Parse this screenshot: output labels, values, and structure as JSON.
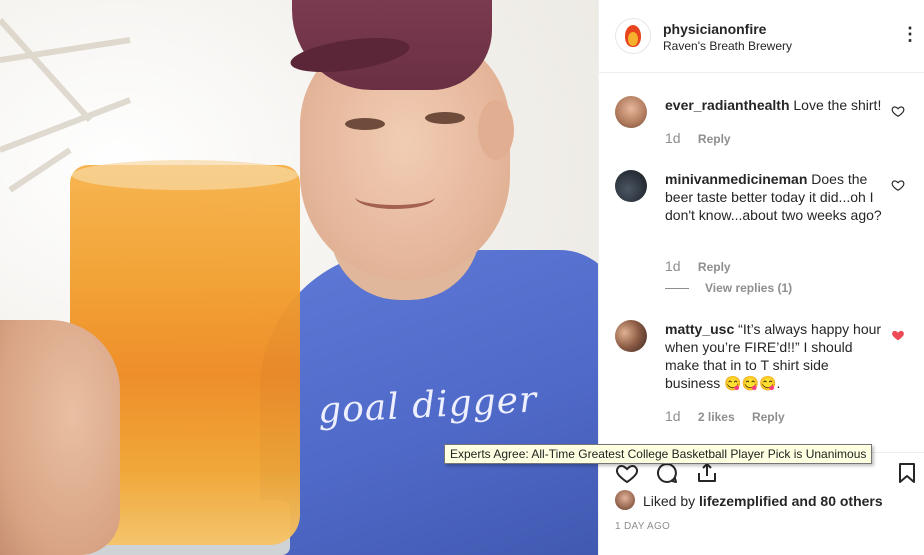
{
  "post": {
    "username": "physicianonfire",
    "location": "Raven's Breath Brewery",
    "shirt_text": "goal digger"
  },
  "comments": [
    {
      "username": "ever_radianthealth",
      "text": "Love the shirt!",
      "age": "1d",
      "likes": "",
      "reply": "Reply",
      "liked": false
    },
    {
      "username": "minivanmedicineman",
      "text": "Does the beer taste better today it did...oh I don't know...about two weeks ago?",
      "age": "1d",
      "likes": "",
      "reply": "Reply",
      "liked": false,
      "view_replies": "View replies (1)"
    },
    {
      "username": "matty_usc",
      "text": "“It’s always happy hour when you’re FIRE’d!!” I should make that in to T shirt side business 😋😋😋.",
      "age": "1d",
      "likes": "2 likes",
      "reply": "Reply",
      "liked": true
    }
  ],
  "tooltip": "Experts Agree: All-Time Greatest College Basketball Player Pick is Unanimous",
  "likes": {
    "prefix": "Liked by ",
    "user": "lifezemplified",
    "suffix": " and 80 others"
  },
  "timestamp": "1 DAY AGO",
  "colors": {
    "liked_heart": "#ed4956",
    "muted": "#8e8e8e",
    "text": "#262626"
  },
  "icons": [
    "more-options-icon",
    "heart-icon",
    "comment-icon",
    "share-icon",
    "bookmark-icon"
  ]
}
